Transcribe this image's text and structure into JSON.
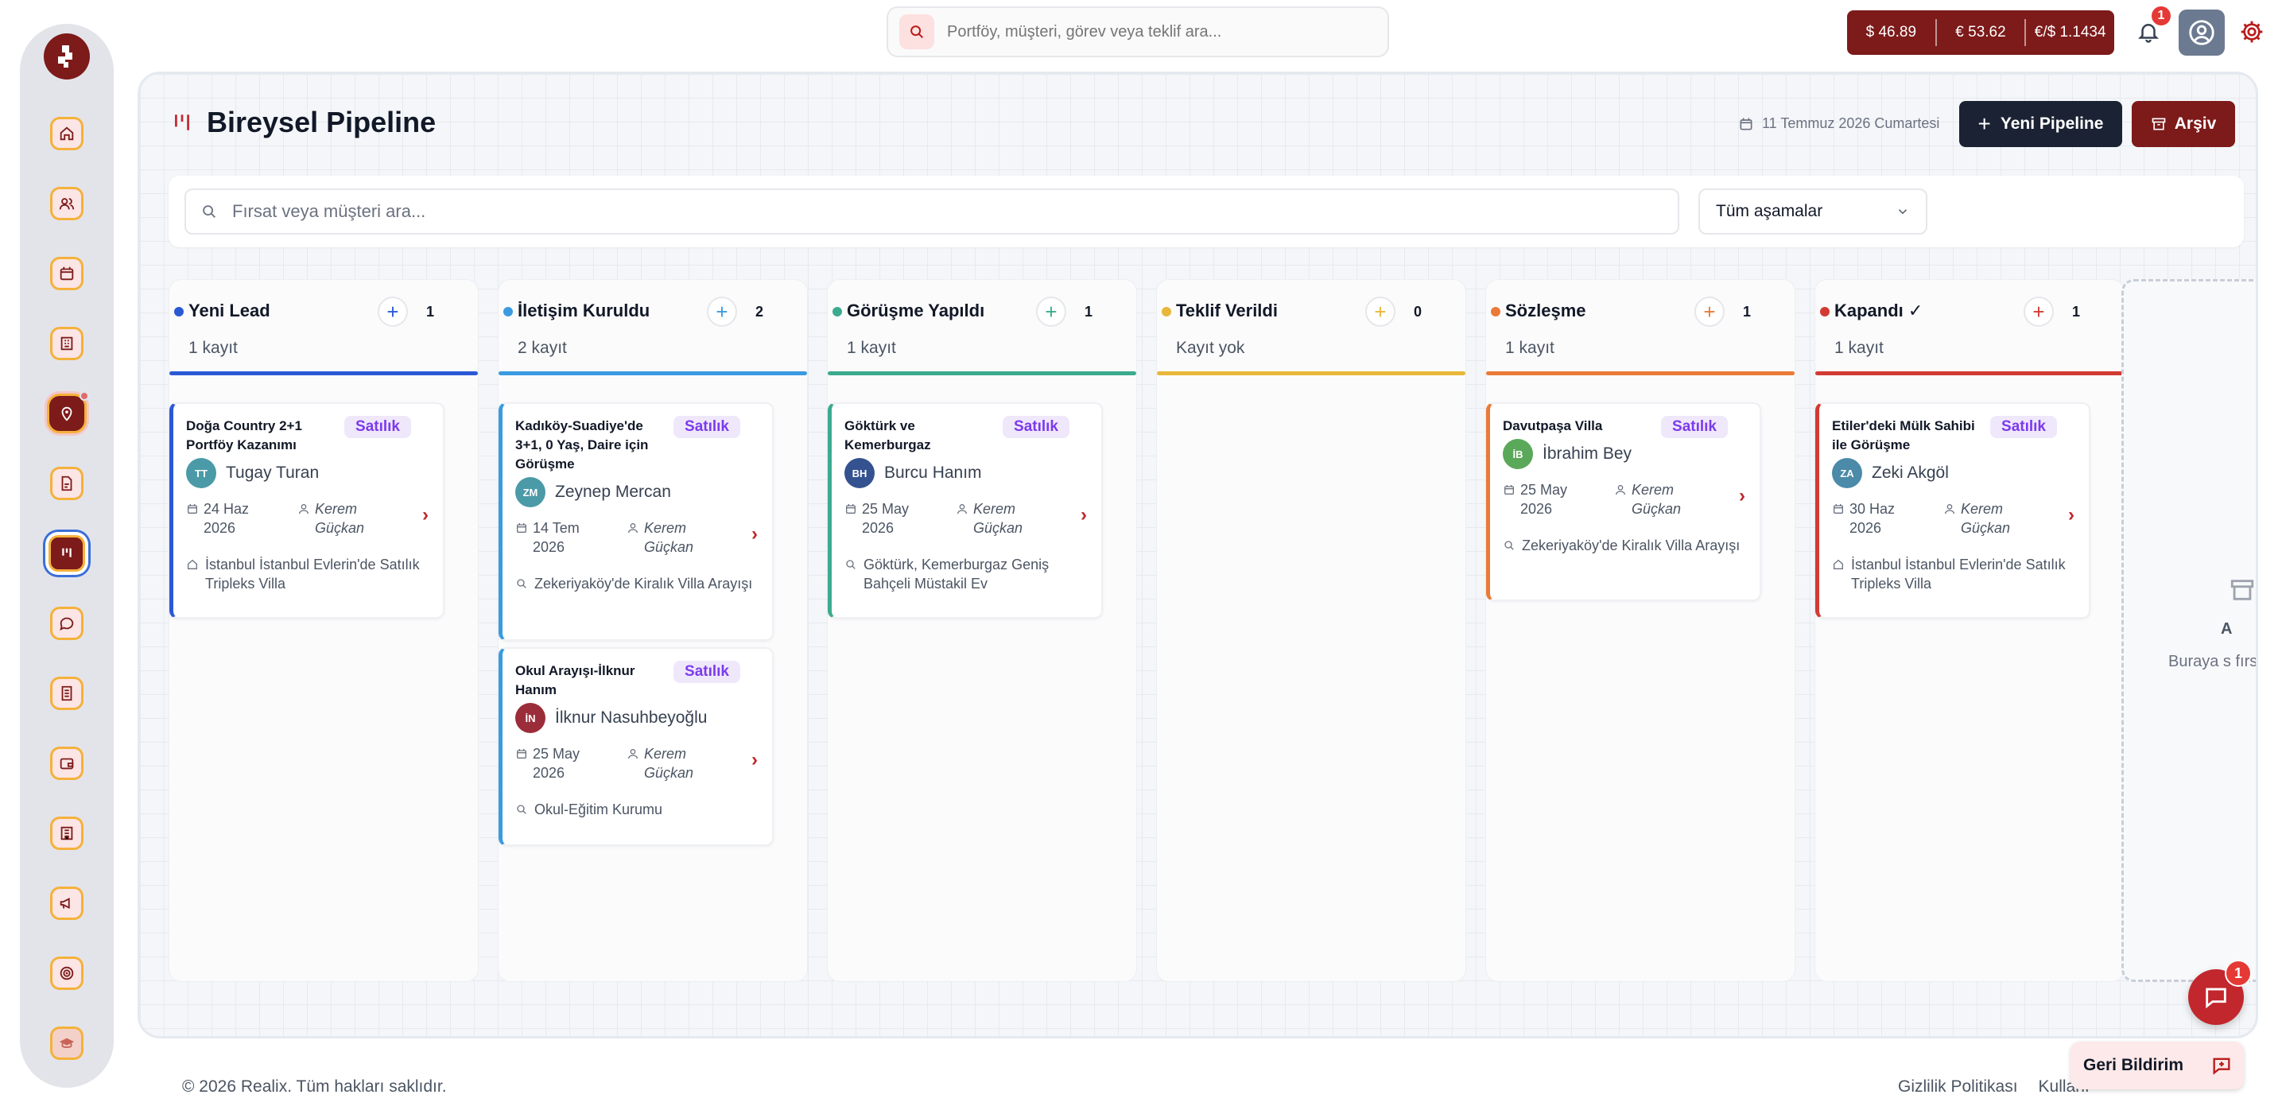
{
  "top_search": {
    "placeholder": "Portföy, müşteri, görev veya teklif ara..."
  },
  "rates": {
    "usd": "$ 46.89",
    "eur": "€ 53.62",
    "eurusd": "€/$ 1.1434"
  },
  "notifications": {
    "count": "1"
  },
  "page": {
    "title": "Bireysel Pipeline",
    "date": "11 Temmuz 2026 Cumartesi",
    "new_pipeline_label": "Yeni Pipeline",
    "archive_label": "Arşiv"
  },
  "filters": {
    "search_placeholder": "Fırsat veya müşteri ara...",
    "stage_selected": "Tüm aşamalar"
  },
  "columns": [
    {
      "title": "Yeni Lead",
      "count": "1",
      "sub": "1 kayıt",
      "color": "#2b59d6",
      "cards": [
        {
          "title": "Doğa Country 2+1 Portföy Kazanımı",
          "tag": "Satılık",
          "initials": "TT",
          "avatar_color": "#4b9aa8",
          "name": "Tugay Turan",
          "date": "24 Haz 2026",
          "agent": "Kerem Güçkan",
          "location": "İstanbul İstanbul Evlerin'de Satılık Tripleks Villa"
        }
      ]
    },
    {
      "title": "İletişim Kuruldu",
      "count": "2",
      "sub": "2 kayıt",
      "color": "#3b9be0",
      "cards": [
        {
          "title": "Kadıköy-Suadiye'de 3+1, 0 Yaş, Daire için Görüşme",
          "tag": "Satılık",
          "initials": "ZM",
          "avatar_color": "#4b9aa8",
          "name": "Zeynep Mercan",
          "date": "14 Tem 2026",
          "agent": "Kerem Güçkan",
          "location": "Zekeriyaköy'de Kiralık Villa Arayışı"
        },
        {
          "title": "Okul Arayışı-İlknur Hanım",
          "tag": "Satılık",
          "initials": "İN",
          "avatar_color": "#9b2d3a",
          "name": "İlknur Nasuhbeyoğlu",
          "date": "25 May 2026",
          "agent": "Kerem Güçkan",
          "location": "Okul-Eğitim Kurumu"
        }
      ]
    },
    {
      "title": "Görüşme Yapıldı",
      "count": "1",
      "sub": "1 kayıt",
      "color": "#3bab8e",
      "cards": [
        {
          "title": "Göktürk ve Kemerburgaz",
          "tag": "Satılık",
          "initials": "BH",
          "avatar_color": "#33528f",
          "name": "Burcu Hanım",
          "date": "25 May 2026",
          "agent": "Kerem Güçkan",
          "location": "Göktürk, Kemerburgaz Geniş Bahçeli Müstakil Ev"
        }
      ]
    },
    {
      "title": "Teklif Verildi",
      "count": "0",
      "sub": "Kayıt yok",
      "color": "#e8b73a",
      "cards": []
    },
    {
      "title": "Sözleşme",
      "count": "1",
      "sub": "1 kayıt",
      "color": "#ea7a37",
      "cards": [
        {
          "title": "Davutpaşa Villa",
          "tag": "Satılık",
          "initials": "İB",
          "avatar_color": "#5aa85a",
          "name": "İbrahim Bey",
          "date": "25 May 2026",
          "agent": "Kerem Güçkan",
          "location": "Zekeriyaköy'de Kiralık Villa Arayışı"
        }
      ]
    },
    {
      "title": "Kapandı ✓",
      "count": "1",
      "sub": "1 kayıt",
      "color": "#d23a34",
      "cards": [
        {
          "title": "Etiler'deki Mülk Sahibi ile Görüşme",
          "tag": "Satılık",
          "initials": "ZA",
          "avatar_color": "#4b8aa8",
          "name": "Zeki Akgöl",
          "date": "30 Haz 2026",
          "agent": "Kerem Güçkan",
          "location": "İstanbul İstanbul Evlerin'de Satılık Tripleks Villa"
        }
      ]
    }
  ],
  "dropzone": {
    "title": "A",
    "text": "Buraya s fırsatlar a"
  },
  "footer": {
    "copyright": "© 2026 Realix. Tüm hakları saklıdır.",
    "privacy": "Gizlilik Politikası",
    "terms": "Kullanı",
    "feedback_label": "Geri Bildirim",
    "chat_badge": "1"
  }
}
